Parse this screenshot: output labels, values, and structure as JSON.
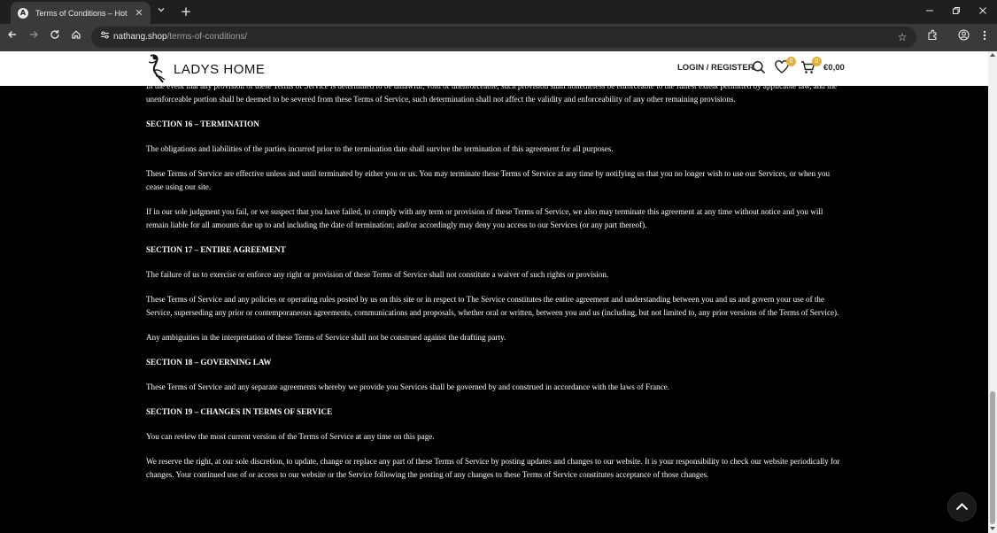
{
  "browser": {
    "tab_title": "Terms of Conditions – Hot Sale",
    "tab_favicon_letter": "A",
    "url_domain": "nathang.shop",
    "url_path": "/terms-of-conditions/"
  },
  "site": {
    "logo_text": "LADYS HOME",
    "login_label": "LOGIN / REGISTER",
    "wishlist_count": "0",
    "cart_count": "0",
    "cart_total": "€0,00"
  },
  "content": {
    "p_severability": "In the event that any provision of these Terms of Service is determined to be unlawful, void or unenforceable, such provision shall nonetheless be enforceable to the fullest extent permitted by applicable law, and the unenforceable portion shall be deemed to be severed from these Terms of Service, such determination shall not affect the validity and enforceability of any other remaining provisions.",
    "s16_title": "SECTION 16 – TERMINATION",
    "s16_p1": "The obligations and liabilities of the parties incurred prior to the termination date shall survive the termination of this agreement for all purposes.",
    "s16_p2": "These Terms of Service are effective unless and until terminated by either you or us. You may terminate these Terms of Service at any time by notifying us that you no longer wish to use our Services, or when you cease using our site.",
    "s16_p3": "If in our sole judgment you fail, or we suspect that you have failed, to comply with any term or provision of these Terms of Service, we also may terminate this agreement at any time without notice and you will remain liable for all amounts due up to and including the date of termination; and/or accordingly may deny you access to our Services (or any part thereof).",
    "s17_title": "SECTION 17 – ENTIRE AGREEMENT",
    "s17_p1": "The failure of us to exercise or enforce any right or provision of these Terms of Service shall not constitute a waiver of such rights or provision.",
    "s17_p2": "These Terms of Service and any policies or operating rules posted by us on this site or in respect to The Service constitutes the entire agreement and understanding between you and us and govern your use of the Service, superseding any prior or contemporaneous agreements, communications and proposals, whether oral or written, between you and us (including, but not limited to, any prior versions of the Terms of Service).",
    "s17_p3": "Any ambiguities in the interpretation of these Terms of Service shall not be construed against the drafting party.",
    "s18_title": "SECTION 18 – GOVERNING LAW",
    "s18_p1": "These Terms of Service and any separate agreements whereby we provide you Services shall be governed by and construed in accordance with the laws of  France.",
    "s19_title": "SECTION 19 – CHANGES IN TERMS OF SERVICE",
    "s19_p1": "You can review the most current version of the Terms of Service at any time on this page.",
    "s19_p2": "We reserve the right, at our sole discretion, to update, change or replace any part of these Terms of Service by posting updates and changes to our website. It is your responsibility to check our website periodically for changes. Your continued use of or access to our website or the Service following the posting of any changes to these Terms of Service constitutes acceptance of those changes."
  }
}
